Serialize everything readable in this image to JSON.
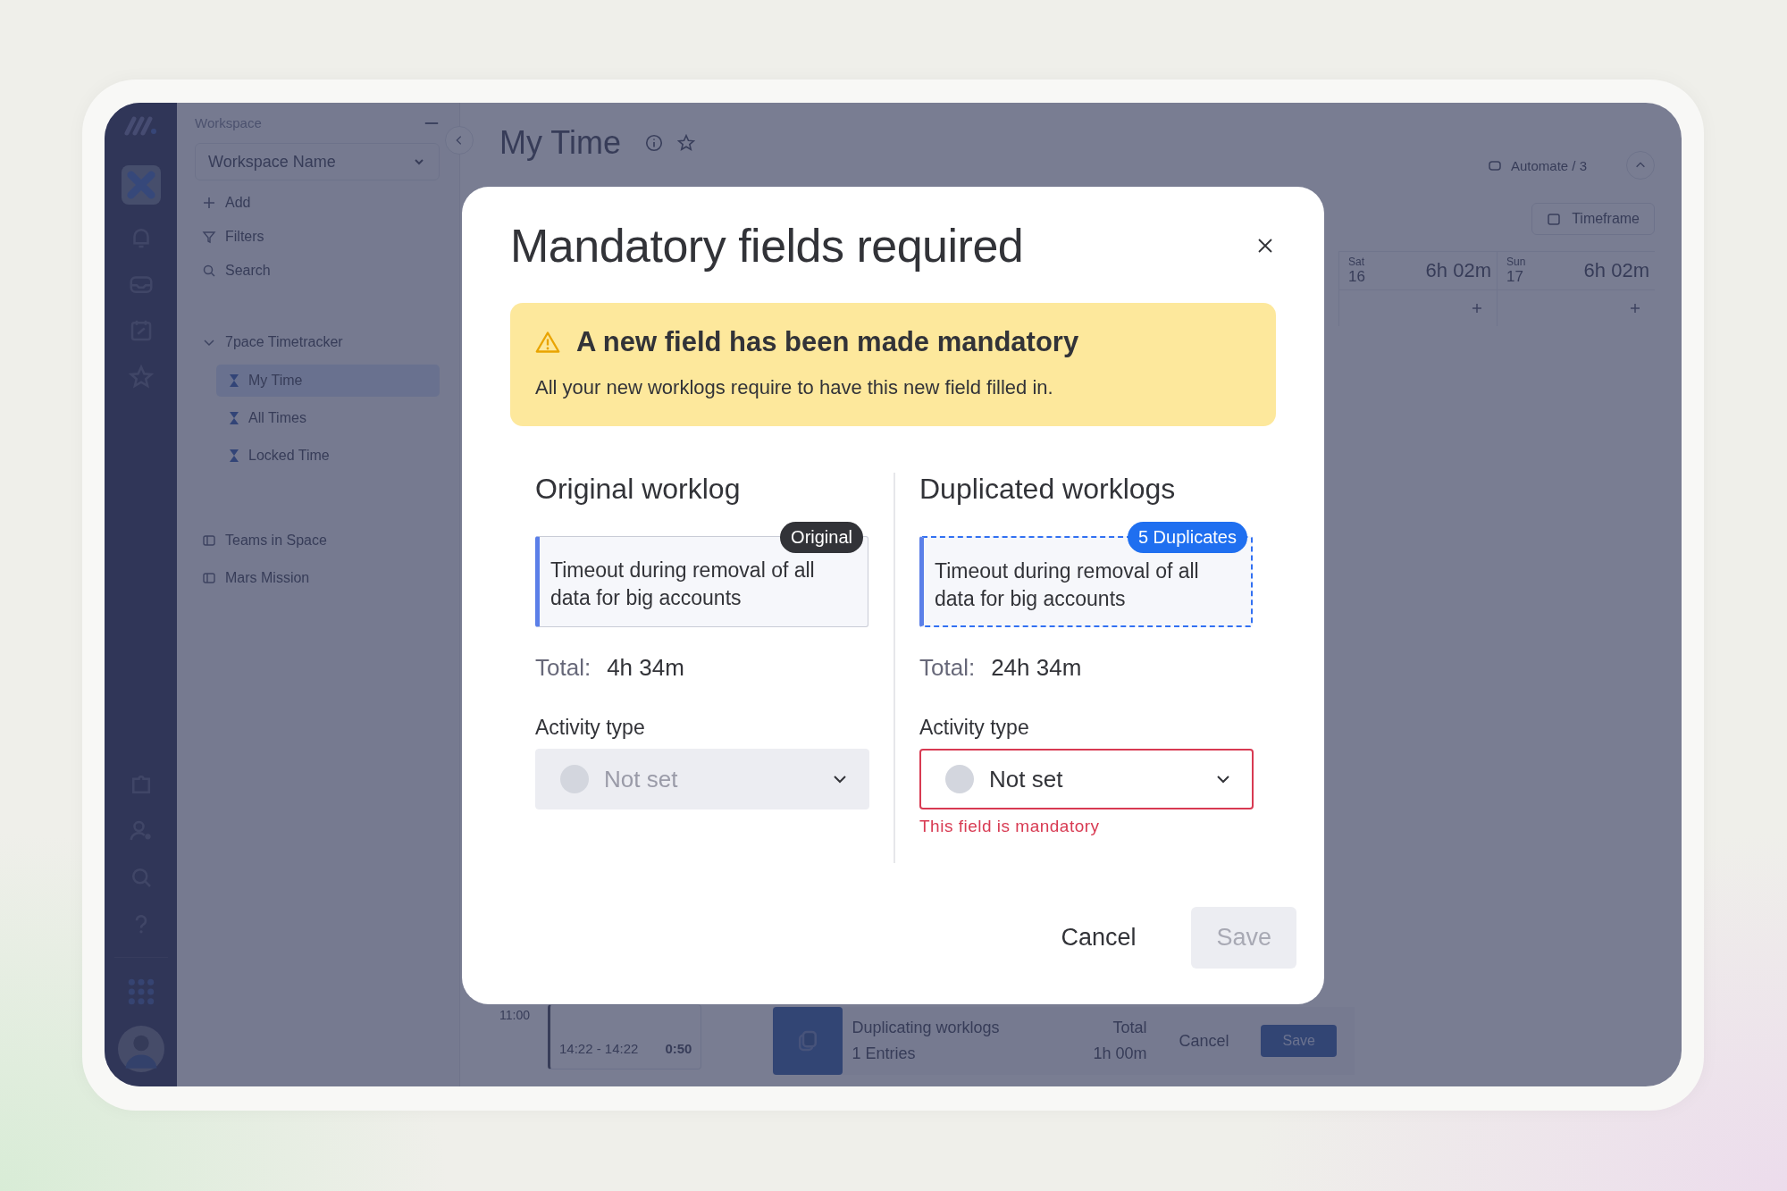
{
  "app": {
    "sidebar": {
      "section_label": "Workspace",
      "workspace": "Workspace Name",
      "actions": [
        {
          "label": "Add",
          "kind": "add"
        },
        {
          "label": "Filters",
          "kind": "filter"
        },
        {
          "label": "Search",
          "kind": "search"
        }
      ],
      "tree": [
        {
          "label": "7pace Timetracker",
          "kind": "folder",
          "expanded": true,
          "children": [
            {
              "label": "My Time",
              "selected": true
            },
            {
              "label": "All Times",
              "selected": false
            },
            {
              "label": "Locked Time",
              "selected": false
            }
          ]
        },
        {
          "label": "Teams in Space",
          "kind": "board"
        },
        {
          "label": "Mars Mission",
          "kind": "board"
        }
      ]
    },
    "header": {
      "title": "My Time",
      "automate": "Automate / 3"
    },
    "toolbar": {
      "timeframe": "Timeframe"
    },
    "days": [
      {
        "weekday": "Sat",
        "date": "16",
        "total": "6h 02m"
      },
      {
        "weekday": "Sun",
        "date": "17",
        "total": "6h 02m"
      }
    ],
    "time_label": "11:00",
    "entry": {
      "range": "14:22 - 14:22",
      "duration": "0:50"
    },
    "bottom_bar": {
      "title": "Duplicating worklogs",
      "entries": "1 Entries",
      "total_label": "Total",
      "total": "1h 00m",
      "cancel": "Cancel",
      "save": "Save"
    }
  },
  "dialog": {
    "title": "Mandatory fields required",
    "alert": {
      "heading": "A new field has been made mandatory",
      "text": "All your new worklogs require to have this new field filled in."
    },
    "columns": [
      {
        "heading": "Original worklog",
        "kind": "original",
        "badge": "Original",
        "card_text": "Timeout during removal of all data for big accounts",
        "total_label": "Total:",
        "total": "4h 34m",
        "field_label": "Activity type",
        "value": "Not set",
        "disabled": true
      },
      {
        "heading": "Duplicated worklogs",
        "kind": "duplicate",
        "badge": "5 Duplicates",
        "card_text": "Timeout during removal of all data for big accounts",
        "total_label": "Total:",
        "total": "24h 34m",
        "field_label": "Activity type",
        "value": "Not set",
        "disabled": false,
        "error": "This field is mandatory"
      }
    ],
    "buttons": [
      {
        "label": "Cancel",
        "kind": "text",
        "disabled": false
      },
      {
        "label": "Save",
        "kind": "primary",
        "disabled": true
      }
    ]
  }
}
